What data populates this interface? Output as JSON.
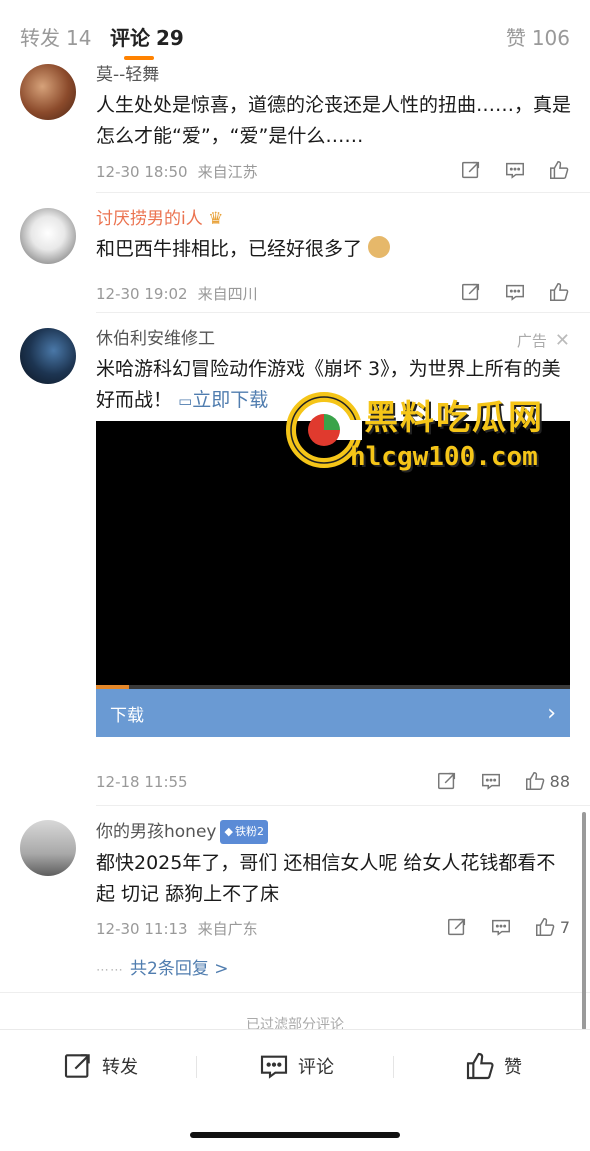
{
  "tabs": {
    "repost_label": "转发",
    "repost_count": "14",
    "comment_label": "评论",
    "comment_count": "29",
    "like_label": "赞",
    "like_count": "106"
  },
  "comments": [
    {
      "user": "莫--轻舞",
      "text": "人生处处是惊喜，道德的沦丧还是人性的扭曲……，真是怎么才能“爱”，“爱”是什么……",
      "time": "12-30 18:50",
      "location": "来自江苏"
    },
    {
      "user": "讨厌捞男的i人",
      "text": "和巴西牛排相比，已经好很多了",
      "time": "12-30 19:02",
      "location": "来自四川"
    },
    {
      "user": "你的男孩honey",
      "badge": "铁粉2",
      "text": "都快2025年了，哥们 还相信女人呢 给女人花钱都看不起 切记 舔狗上不了床",
      "time": "12-30 11:13",
      "location": "来自广东",
      "like_count": "7",
      "replies_label": "共2条回复 >"
    }
  ],
  "ad": {
    "user": "休伯利安维修工",
    "tag": "广告",
    "text": "米哈游科幻冒险动作游戏《崩坏 3》，为世界上所有的美好而战！",
    "link_label": "立即下载",
    "download_label": "下载",
    "video_progress": 0.07,
    "time": "12-18 11:55",
    "like_count": "88"
  },
  "filtered_notice": "已过滤部分评论",
  "bottom_bar": {
    "repost_label": "转发",
    "comment_label": "评论",
    "like_label": "赞"
  },
  "watermark": {
    "line1": "黑料吃瓜网",
    "line2": "hlcgw100.com"
  },
  "colors": {
    "accent": "#ff8200",
    "link": "#507daf",
    "download_bar": "#6a9ad3",
    "username_highlight": "#eb7350"
  }
}
